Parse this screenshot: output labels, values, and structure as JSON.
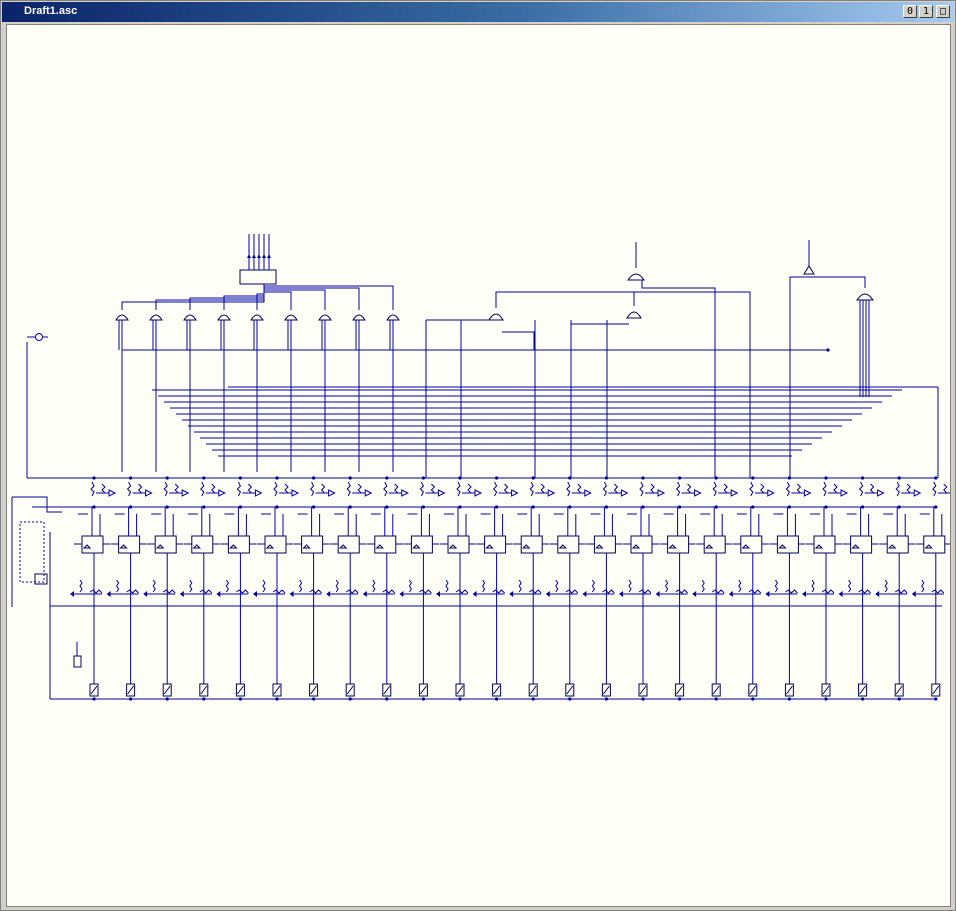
{
  "window": {
    "title": "Draft1.asc",
    "buttons": [
      {
        "name": "minimize-button",
        "label": "0"
      },
      {
        "name": "restore-button",
        "label": "1"
      },
      {
        "name": "maximize-button",
        "label": "□"
      }
    ]
  },
  "colors": {
    "titlebar_start": "#0a246a",
    "titlebar_end": "#a6caf0",
    "canvas_background": "#fffff7",
    "wire": "#0000a8",
    "component": "#000060"
  },
  "schematic": {
    "stage_count": 24,
    "gate_rows": [
      {
        "name": "upper-or-gates",
        "count": 9
      },
      {
        "name": "right-or-gates",
        "count": 3
      }
    ]
  }
}
